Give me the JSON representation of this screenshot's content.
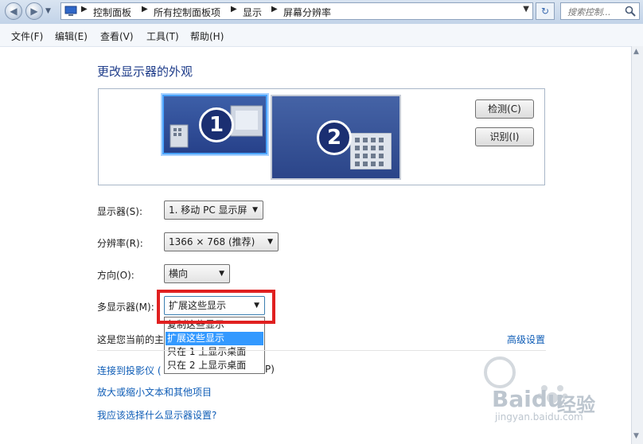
{
  "address_bar": {
    "breadcrumbs": [
      "控制面板",
      "所有控制面板项",
      "显示",
      "屏幕分辨率"
    ],
    "search_placeholder": "搜索控制..."
  },
  "menu": {
    "items": [
      "文件(F)",
      "编辑(E)",
      "查看(V)",
      "工具(T)",
      "帮助(H)"
    ]
  },
  "page": {
    "heading": "更改显示器的外观",
    "monitors": [
      {
        "number": "1",
        "selected": true
      },
      {
        "number": "2",
        "selected": false
      }
    ],
    "detect_button": "检测(C)",
    "identify_button": "识别(I)"
  },
  "settings": {
    "display_label": "显示器(S):",
    "display_value": "1. 移动 PC 显示屏",
    "resolution_label": "分辨率(R):",
    "resolution_value": "1366 × 768 (推荐)",
    "orientation_label": "方向(O):",
    "orientation_value": "横向",
    "multi_label": "多显示器(M):",
    "multi_value": "扩展这些显示",
    "multi_options": [
      "复制这些显示",
      "扩展这些显示",
      "只在 1 上显示桌面",
      "只在 2 上显示桌面"
    ],
    "multi_selected_index": 1
  },
  "info": {
    "text": "这是您当前的主",
    "advanced_link": "高级设置"
  },
  "links": {
    "projector": "连接到投影仪 (",
    "projector_tail": "P)",
    "text_size": "放大或缩小文本和其他项目",
    "which_settings": "我应该选择什么显示器设置?"
  },
  "watermark": {
    "cn": "Bai 经验",
    "brand": "Baidu",
    "jingyan": "经验",
    "url": "jingyan.baidu.com"
  },
  "colors": {
    "highlight_box": "#e02020",
    "selection": "#3399ff",
    "link": "#0e5cb6",
    "heading": "#1e3c8a"
  }
}
